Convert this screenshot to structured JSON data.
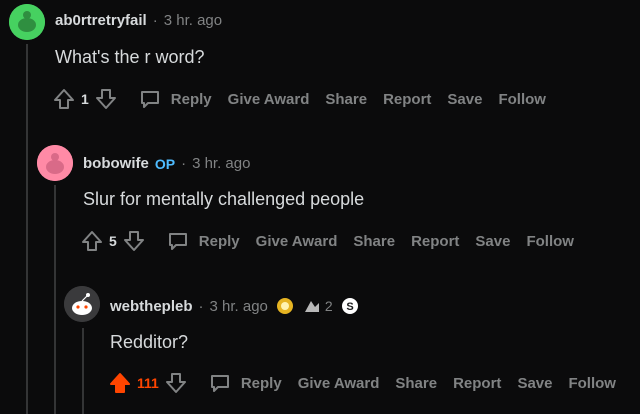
{
  "comments": [
    {
      "username": "ab0rtretryfail",
      "time": "3 hr. ago",
      "text": "What's the r word?",
      "score": "1",
      "avatar_color": "#46d160"
    },
    {
      "username": "bobowife",
      "op_label": "OP",
      "time": "3 hr. ago",
      "text": "Slur for mentally challenged people",
      "score": "5",
      "avatar_color": "#ff8aa6"
    },
    {
      "username": "webthepleb",
      "time": "3 hr. ago",
      "text": "Redditor?",
      "score": "111",
      "award_count": "2",
      "avatar_color": "#5b5b5b"
    }
  ],
  "actions": {
    "reply": "Reply",
    "give_award": "Give Award",
    "share": "Share",
    "report": "Report",
    "save": "Save",
    "follow": "Follow"
  },
  "separator": "·",
  "colors": {
    "upvoted": "#ff4500",
    "op": "#4fbcff",
    "muted": "#818384"
  }
}
